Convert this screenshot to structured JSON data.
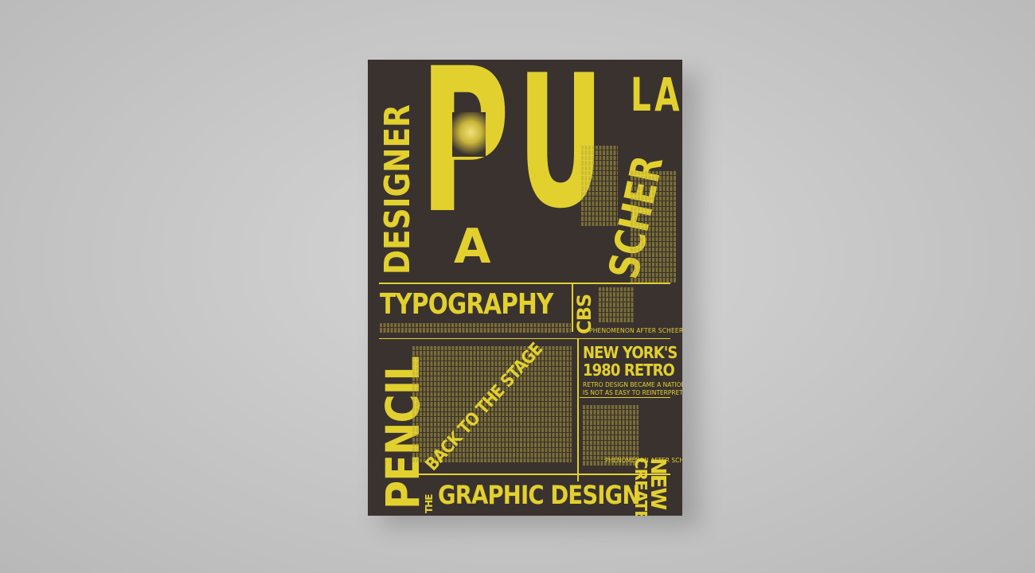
{
  "poster": {
    "big_p": "P",
    "big_u": "U",
    "big_a": "A",
    "la": "LA",
    "designer": "DESIGNER",
    "scher": "SCHER",
    "typography": "TYPOGRAPHY",
    "cbs": "CBS",
    "phenomenon_1": "PHENOMENON AFTER SCHEER DESIGN",
    "ny_retro": "NEW YORK'S\n1980 RETRO",
    "retro_sub": "RETRO DESIGN BECAME A NATIONAL IT\nIS NOT AS EASY TO REINTERPRET",
    "pencil": "PENCIL",
    "back_to_stage": "BACK TO THE STAGE",
    "create": "CREATE",
    "new": "NEW",
    "phenomenon_2": "PHENOMENON AFTER SCHEER DESIGN",
    "the": "THE",
    "graphic_design": "GRAPHIC DESIGN"
  },
  "colors": {
    "background": "#c4c4c4",
    "poster": "#3a322f",
    "accent": "#e2d02f"
  }
}
